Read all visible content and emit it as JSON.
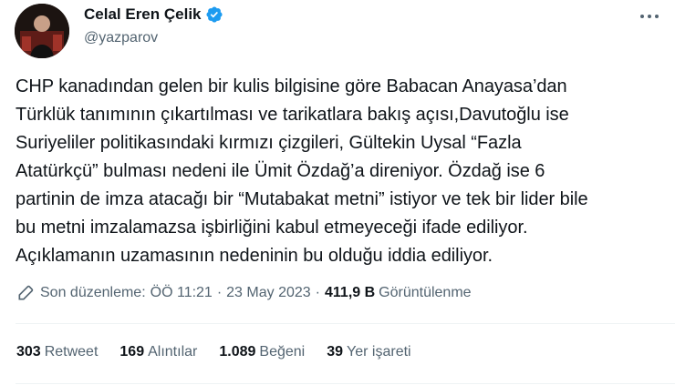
{
  "author": {
    "name": "Celal Eren Çelik",
    "handle": "@yazparov",
    "verified": true
  },
  "tweet": {
    "lines": [
      "CHP kanadından gelen bir kulis bilgisine göre Babacan Anayasa’dan",
      "Türklük tanımının çıkartılması ve tarikatlara bakış açısı,Davutoğlu ise",
      "Suriyeliler politikasındaki kırmızı çizgileri, Gültekin Uysal “Fazla",
      "Atatürkçü” bulması nedeni ile Ümit Özdağ’a direniyor. Özdağ ise 6",
      "partinin de imza atacağı bir “Mutabakat metni” istiyor ve tek bir lider bile",
      "bu metni imzalamazsa işbirliğini kabul etmeyeceği ifade ediliyor.",
      "Açıklamanın uzamasının nedeninin bu olduğu iddia ediliyor."
    ]
  },
  "meta": {
    "edited_label": "Son düzenleme:",
    "time": "ÖÖ 11:21",
    "separator": "·",
    "date": "23 May 2023",
    "views_count": "411,9 B",
    "views_label": "Görüntülenme"
  },
  "stats": {
    "retweets": {
      "count": "303",
      "label": "Retweet"
    },
    "quotes": {
      "count": "169",
      "label": "Alıntılar"
    },
    "likes": {
      "count": "1.089",
      "label": "Beğeni"
    },
    "bookmarks": {
      "count": "39",
      "label": "Yer işareti"
    }
  },
  "colors": {
    "text_primary": "#0f1419",
    "text_secondary": "#536471",
    "verified_blue": "#1d9bf0",
    "divider": "#eff3f4"
  },
  "icons": {
    "verified": "verified-badge-icon",
    "more": "more-dots-icon",
    "edit": "pencil-icon"
  }
}
